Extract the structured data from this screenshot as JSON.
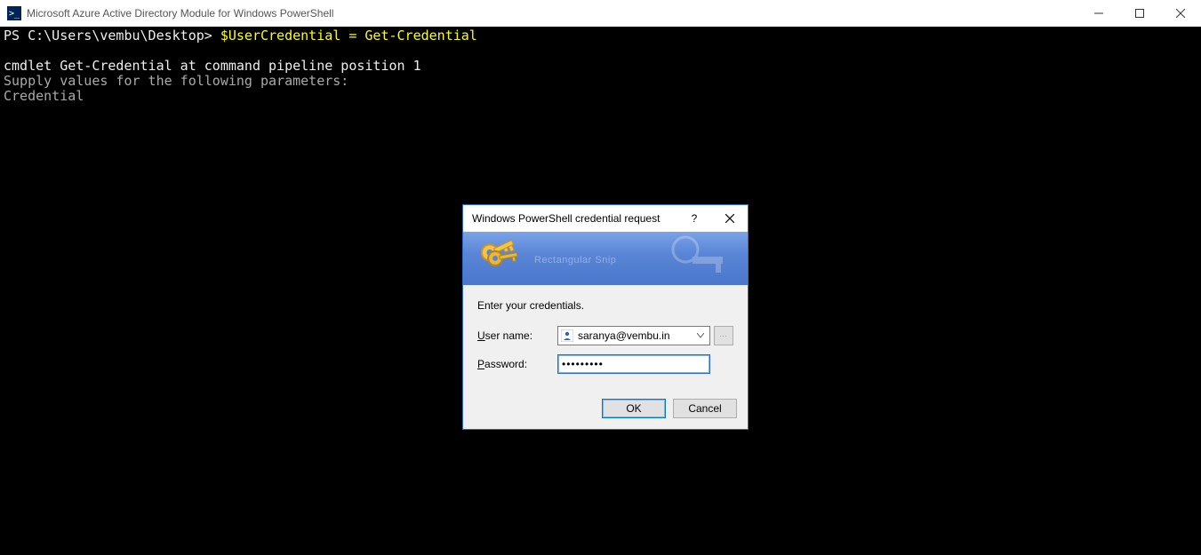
{
  "window": {
    "title": "Microsoft Azure Active Directory Module for Windows PowerShell",
    "ps_glyph": ">_"
  },
  "terminal": {
    "prompt_prefix": "PS C:\\Users\\vembu\\Desktop> ",
    "command": "$UserCredential = Get-Credential",
    "line1": "cmdlet Get-Credential at command pipeline position 1",
    "line2": "Supply values for the following parameters:",
    "line3": "Credential"
  },
  "dialog": {
    "title": "Windows PowerShell credential request",
    "help_glyph": "?",
    "close_glyph": "✕",
    "banner_watermark": "Rectangular Snip",
    "prompt": "Enter your credentials.",
    "username_label_u": "U",
    "username_label_rest": "ser name:",
    "username_value": "saranya@vembu.in",
    "password_label_p": "P",
    "password_label_rest": "assword:",
    "password_value": "•••••••••",
    "browse_label": "...",
    "ok_label": "OK",
    "cancel_label": "Cancel"
  }
}
